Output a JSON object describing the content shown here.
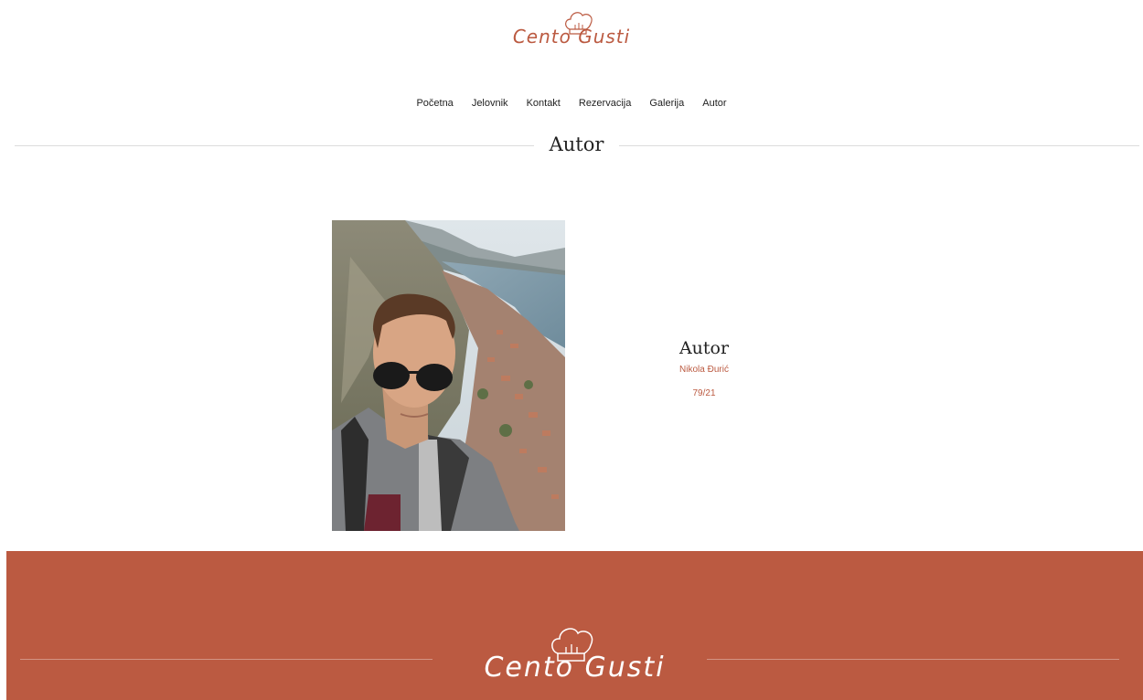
{
  "header": {
    "logo_text": "Cento Gusti",
    "logo_icon": "chef-hat-icon"
  },
  "nav": {
    "items": [
      {
        "label": "Početna"
      },
      {
        "label": "Jelovnik"
      },
      {
        "label": "Kontakt"
      },
      {
        "label": "Rezervacija"
      },
      {
        "label": "Galerija"
      },
      {
        "label": "Autor"
      }
    ]
  },
  "main": {
    "section_title": "Autor",
    "info": {
      "title": "Autor",
      "name": "Nikola Đurić",
      "index": "79/21"
    }
  },
  "footer": {
    "logo_text": "Cento Gusti",
    "logo_icon": "chef-hat-icon"
  },
  "colors": {
    "accent": "#bb5a41",
    "text": "#222222",
    "divider": "#dcdcdc",
    "background": "#ffffff"
  }
}
